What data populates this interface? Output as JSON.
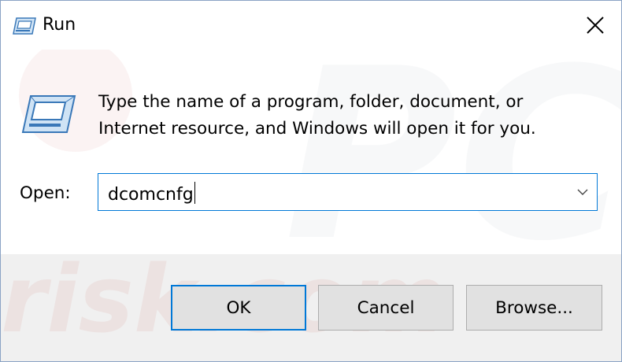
{
  "window": {
    "title": "Run"
  },
  "message": {
    "line1": "Type the name of a program, folder, document, or",
    "line2": "Internet resource, and Windows will open it for you."
  },
  "open_field": {
    "label": "Open:",
    "value": "dcomcnfg"
  },
  "buttons": {
    "ok": "OK",
    "cancel": "Cancel",
    "browse": "Browse..."
  },
  "watermark": {
    "line1": "PC",
    "line2": "risk.com"
  },
  "icons": {
    "title": "run-icon",
    "close": "close-icon",
    "dropdown": "chevron-down-icon",
    "big": "run-icon"
  },
  "colors": {
    "accent": "#0078d7",
    "footer_bg": "#f0f0f0",
    "button_bg": "#e1e1e1"
  }
}
